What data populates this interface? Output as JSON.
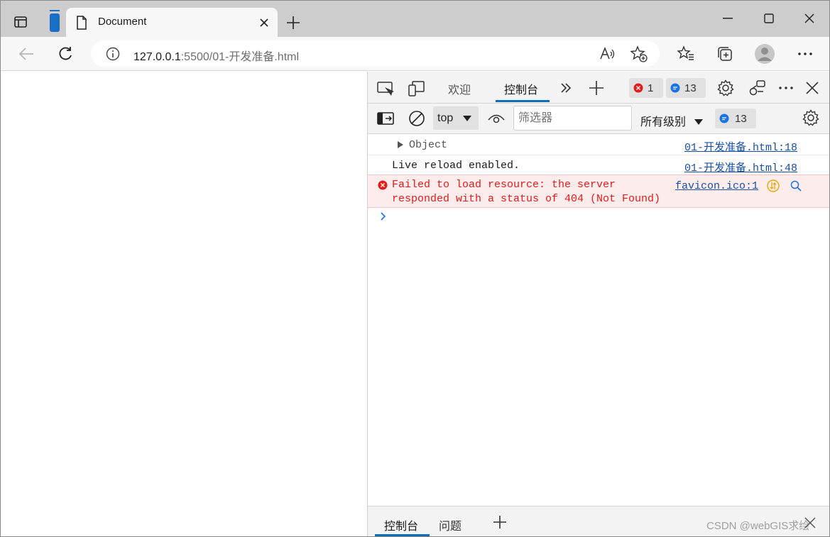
{
  "browser": {
    "tab_title": "Document",
    "url_host": "127.0.0.1",
    "url_rest": ":5500/01-开发准备.html"
  },
  "devtools": {
    "tabs": {
      "welcome": "欢迎",
      "console": "控制台"
    },
    "error_count": "1",
    "message_count": "13",
    "context": "top",
    "filter_placeholder": "筛选器",
    "levels_label": "所有级别",
    "levels_message_count": "13",
    "console_rows": [
      {
        "text": "Object",
        "source": "01-开发准备.html:18"
      },
      {
        "text": "Live reload enabled.",
        "source": "01-开发准备.html:48"
      },
      {
        "text_line1": "Failed to load resource: the server",
        "text_line2": "responded with a status of 404 (Not Found)",
        "source": "favicon.ico:1"
      }
    ],
    "drawer_tabs": {
      "console": "控制台",
      "issues": "问题"
    }
  },
  "watermark": "CSDN @webGIS求绘",
  "colors": {
    "accent": "#0f6cbd",
    "error": "#e01b1b",
    "error_bg": "#fdecec",
    "info_badge": "#1a73e8"
  }
}
